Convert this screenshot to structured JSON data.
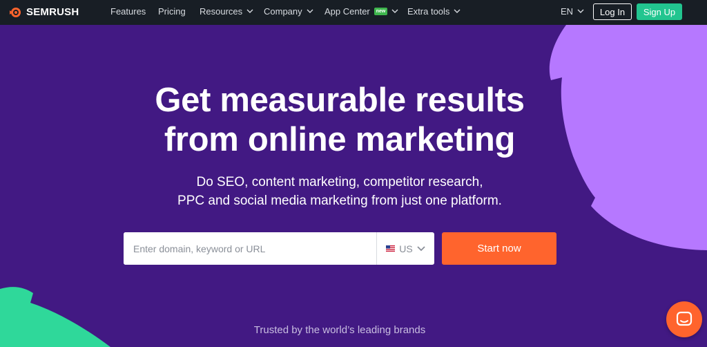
{
  "brand": {
    "name": "SEMRUSH",
    "logo_icon": "semrush-fire-icon",
    "accent": "#ff642d"
  },
  "nav": {
    "items": [
      {
        "label": "Features",
        "has_dropdown": false
      },
      {
        "label": "Pricing",
        "has_dropdown": false
      },
      {
        "label": "Resources",
        "has_dropdown": true
      },
      {
        "label": "Company",
        "has_dropdown": true
      },
      {
        "label": "App Center",
        "has_dropdown": true,
        "badge": "new"
      },
      {
        "label": "Extra tools",
        "has_dropdown": true
      }
    ],
    "language": "EN",
    "login_label": "Log In",
    "signup_label": "Sign Up"
  },
  "hero": {
    "headline_line1": "Get measurable results",
    "headline_line2": "from online marketing",
    "subtitle_line1": "Do SEO, content marketing, competitor research,",
    "subtitle_line2": "PPC and social media marketing from just one platform.",
    "search_placeholder": "Enter domain, keyword or URL",
    "search_value": "",
    "country": "US",
    "country_flag_icon": "us-flag-icon",
    "start_label": "Start now",
    "trusted_text": "Trusted by the world’s leading brands"
  },
  "chat": {
    "icon": "chat-bubble-icon"
  },
  "colors": {
    "background": "#421983",
    "nav_background": "#181e25",
    "signup": "#22c58f",
    "shape_right": "#b678ff",
    "shape_left": "#2fd89a"
  }
}
